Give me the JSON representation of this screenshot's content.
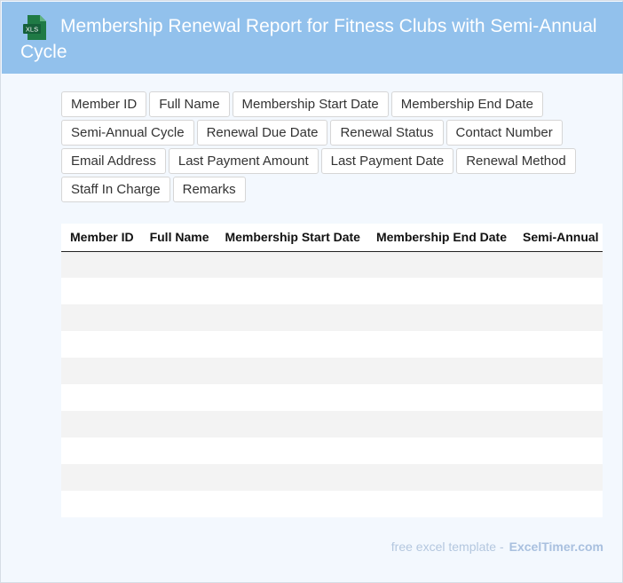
{
  "header": {
    "icon_name": "xls-file-icon",
    "icon_text": "XLS",
    "title": "Membership Renewal Report for Fitness Clubs with Semi-Annual Cycle",
    "background_color": "#92c1ec"
  },
  "field_chips": [
    "Member ID",
    "Full Name",
    "Membership Start Date",
    "Membership End Date",
    "Semi-Annual Cycle",
    "Renewal Due Date",
    "Renewal Status",
    "Contact Number",
    "Email Address",
    "Last Payment Amount",
    "Last Payment Date",
    "Renewal Method",
    "Staff In Charge",
    "Remarks"
  ],
  "table": {
    "columns": [
      "Member ID",
      "Full Name",
      "Membership Start Date",
      "Membership End Date",
      "Semi-Annual Cycle"
    ],
    "row_count": 10
  },
  "footer": {
    "text": "free excel template -",
    "brand": "ExcelTimer.com"
  }
}
